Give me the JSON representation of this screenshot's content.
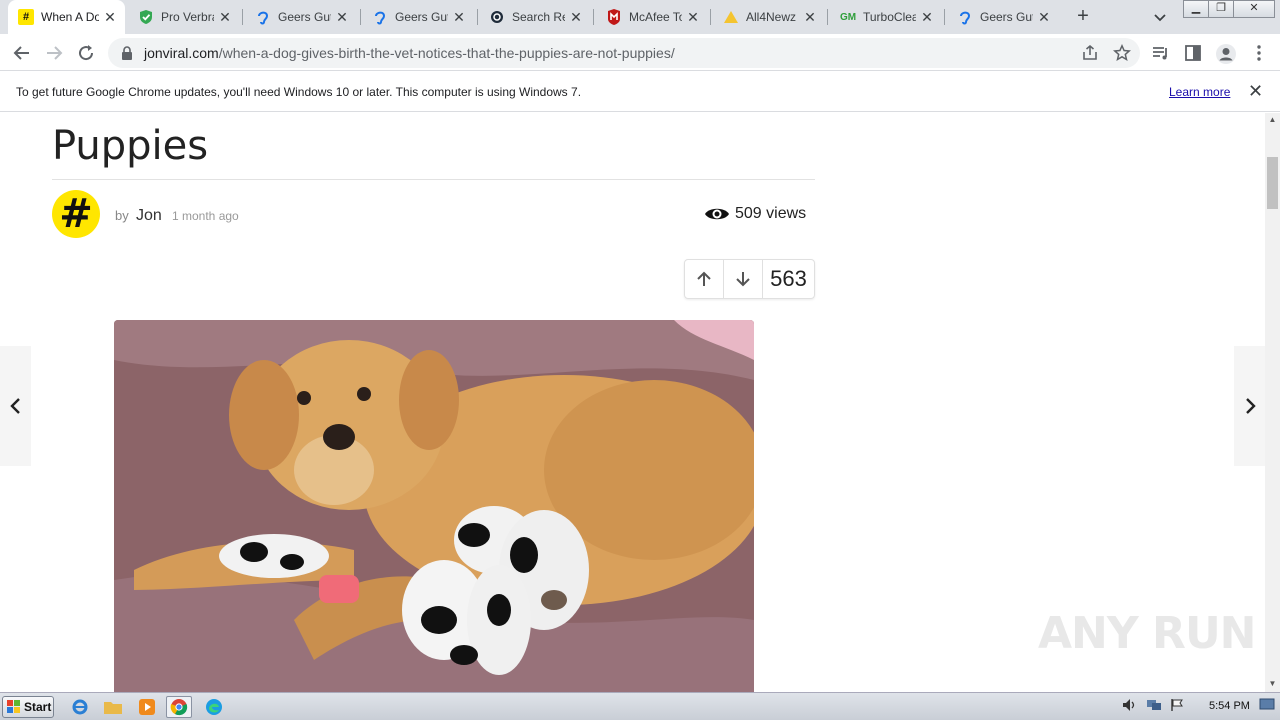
{
  "browser": {
    "tabs": [
      {
        "title": "When A Dog",
        "favicon": "hash-yellow",
        "active": true
      },
      {
        "title": "Pro Verbra",
        "favicon": "shield-green"
      },
      {
        "title": "Geers Gute",
        "favicon": "ear-blue"
      },
      {
        "title": "Geers Gute",
        "favicon": "ear-blue"
      },
      {
        "title": "Search Res",
        "favicon": "search-dark"
      },
      {
        "title": "McAfee Tot",
        "favicon": "mcafee-red"
      },
      {
        "title": "All4Newz",
        "favicon": "warning-yellow"
      },
      {
        "title": "TurboClean",
        "favicon": "gm-green"
      },
      {
        "title": "Geers Gute",
        "favicon": "ear-blue"
      }
    ],
    "new_tab": "+",
    "url_host": "jonviral.com",
    "url_path": "/when-a-dog-gives-birth-the-vet-notices-that-the-puppies-are-not-puppies/"
  },
  "infobar": {
    "message": "To get future Google Chrome updates, you'll need Windows 10 or later. This computer is using Windows 7.",
    "learn_more": "Learn more"
  },
  "article": {
    "title": "Puppies",
    "author_prefix": "by",
    "author": "Jon",
    "time": "1 month ago",
    "views": "509 views",
    "vote_count": "563",
    "avatar_glyph": "#"
  },
  "watermark": "ANY RUN",
  "taskbar": {
    "start_label": "Start",
    "clock": "5:54 PM"
  },
  "colors": {
    "accent_yellow": "#ffe600",
    "tab_strip": "#dee1e6",
    "link": "#1a0dab"
  }
}
